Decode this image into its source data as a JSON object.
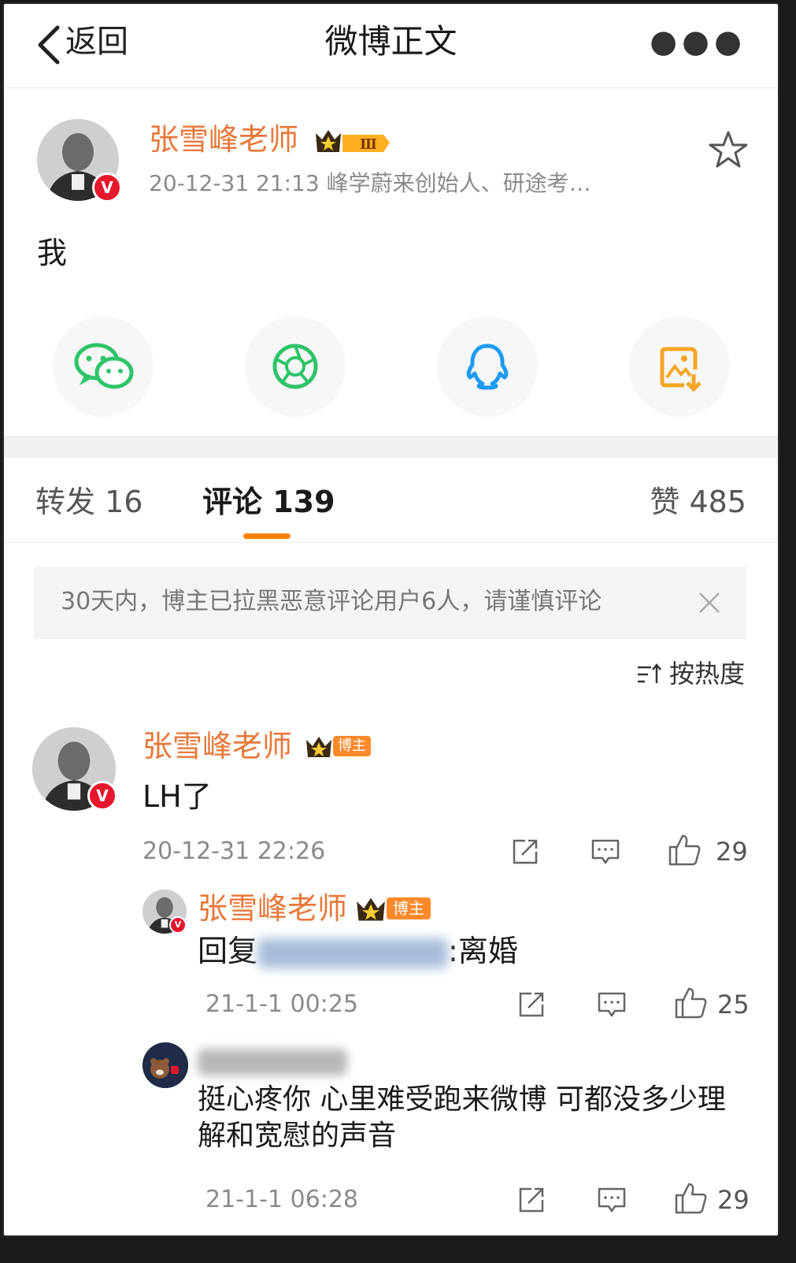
{
  "header": {
    "back_label": "返回",
    "title": "微博正文"
  },
  "post": {
    "author": "张雪峰老师",
    "meta": "20-12-31 21:13  峰学蔚来创始人、研途考…",
    "body": "我",
    "level_badge": "Ⅲ"
  },
  "share_targets": [
    {
      "icon": "wechat-icon",
      "color": "#2fc46b"
    },
    {
      "icon": "moments-icon",
      "color": "#2fc46b"
    },
    {
      "icon": "qq-icon",
      "color": "#1d9bf0"
    },
    {
      "icon": "save-image-icon",
      "color": "#f5a623"
    }
  ],
  "tabs": {
    "repost": "转发 16",
    "comments": "评论 139",
    "likes": "赞 485"
  },
  "notice": "30天内，博主已拉黑恶意评论用户6人，请谨慎评论",
  "sort_label": "按热度",
  "comments": [
    {
      "author": "张雪峰老师",
      "badge": "博主",
      "text": "LH了",
      "time": "20-12-31 22:26",
      "likes": "29"
    },
    {
      "author": "张雪峰老师",
      "badge": "博主",
      "reply_prefix": "回复",
      "reply_suffix": ":离婚",
      "time": "21-1-1 00:25",
      "likes": "25"
    },
    {
      "text": "挺心疼你 心里难受跑来微博 可都没多少理解和宽慰的声音",
      "time": "21-1-1 06:28",
      "likes": "29"
    }
  ],
  "colors": {
    "accent": "#ff8200",
    "author": "#e8783a",
    "verified": "#e6162d"
  }
}
